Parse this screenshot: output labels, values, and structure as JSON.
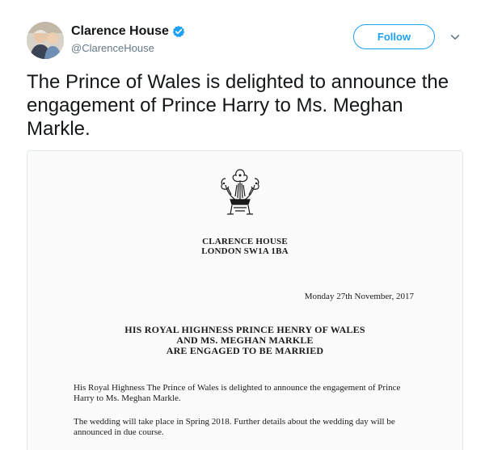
{
  "tweet": {
    "author": {
      "display_name": "Clarence House",
      "handle": "@ClarenceHouse",
      "verified": true
    },
    "follow_label": "Follow",
    "menu_icon": "chevron-down-icon",
    "text": "The Prince of Wales is delighted to announce the engagement of Prince Harry to Ms. Meghan Markle."
  },
  "document": {
    "address_line1": "CLARENCE HOUSE",
    "address_line2": "LONDON SW1A 1BA",
    "date": "Monday 27th November, 2017",
    "headline_line1": "HIS ROYAL HIGHNESS PRINCE HENRY OF WALES",
    "headline_line2": "AND MS. MEGHAN MARKLE",
    "headline_line3": "ARE ENGAGED TO BE MARRIED",
    "paragraph1": "His Royal Highness The Prince of Wales is delighted to announce the engagement of Prince Harry to Ms. Meghan Markle.",
    "paragraph2": "The wedding will take place in Spring 2018. Further details about the wedding day will be announced in due course."
  },
  "colors": {
    "brand_blue": "#1da1f2",
    "text_primary": "#14171a",
    "text_secondary": "#657786"
  }
}
